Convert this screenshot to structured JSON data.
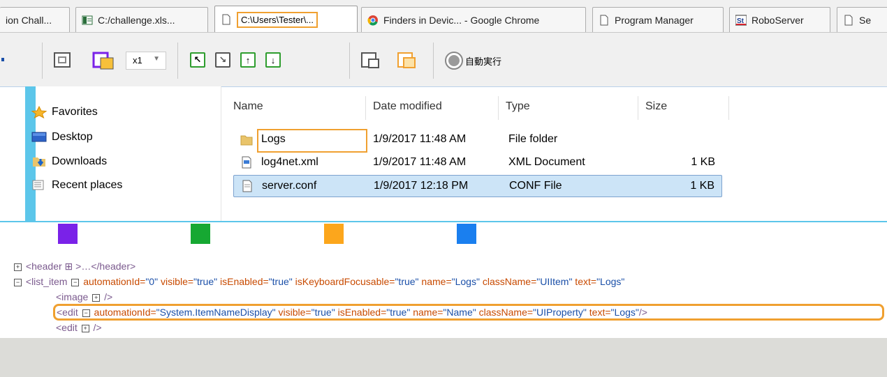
{
  "tabs": [
    {
      "label": "ion Chall...",
      "icon": "document-icon"
    },
    {
      "label": "C:/challenge.xls...",
      "icon": "spreadsheet-icon"
    },
    {
      "label": "C:\\Users\\Tester\\...",
      "icon": "document-icon",
      "active": true
    },
    {
      "label": "Finders in Devic... - Google Chrome",
      "icon": "chrome-icon"
    },
    {
      "label": "Program Manager",
      "icon": "document-icon"
    },
    {
      "label": "RoboServer",
      "icon": "roboserver-icon"
    },
    {
      "label": "Se",
      "icon": "document-icon"
    }
  ],
  "toolbar": {
    "zoom_value": "x1",
    "auto_run_label": "自動実行"
  },
  "nav": {
    "favorites": "Favorites",
    "items": [
      "Desktop",
      "Downloads",
      "Recent places"
    ]
  },
  "columns": {
    "name": "Name",
    "date": "Date modified",
    "type": "Type",
    "size": "Size"
  },
  "files": [
    {
      "name": "Logs",
      "date": "1/9/2017 11:48 AM",
      "type": "File folder",
      "size": ""
    },
    {
      "name": "log4net.xml",
      "date": "1/9/2017 11:48 AM",
      "type": "XML Document",
      "size": "1 KB"
    },
    {
      "name": "server.conf",
      "date": "1/9/2017 12:18 PM",
      "type": "CONF File",
      "size": "1 KB"
    }
  ],
  "swatch_colors": [
    "#7a22e8",
    "#16a832",
    "#fca61c",
    "#1a7fef"
  ],
  "tree": {
    "header_line": "<header ⊞ >…</header>",
    "list_item_open": "<list_item",
    "list_item_attrs": [
      {
        "k": "automationId",
        "v": "\"0\""
      },
      {
        "k": "visible",
        "v": "\"true\""
      },
      {
        "k": "isEnabled",
        "v": "\"true\""
      },
      {
        "k": "isKeyboardFocusable",
        "v": "\"true\""
      },
      {
        "k": "name",
        "v": "\"Logs\""
      },
      {
        "k": "className",
        "v": "\"UIItem\""
      },
      {
        "k": "text",
        "v": "\"Logs\""
      }
    ],
    "image_line": "<image",
    "edit_open": "<edit",
    "edit_attrs": [
      {
        "k": "automationId",
        "v": "\"System.ItemNameDisplay\""
      },
      {
        "k": "visible",
        "v": "\"true\""
      },
      {
        "k": "isEnabled",
        "v": "\"true\""
      },
      {
        "k": "name",
        "v": "\"Name\""
      },
      {
        "k": "className",
        "v": "\"UIProperty\""
      },
      {
        "k": "text",
        "v": "\"Logs\""
      }
    ],
    "edit2_line": "<edit",
    "self_close": "/>"
  }
}
